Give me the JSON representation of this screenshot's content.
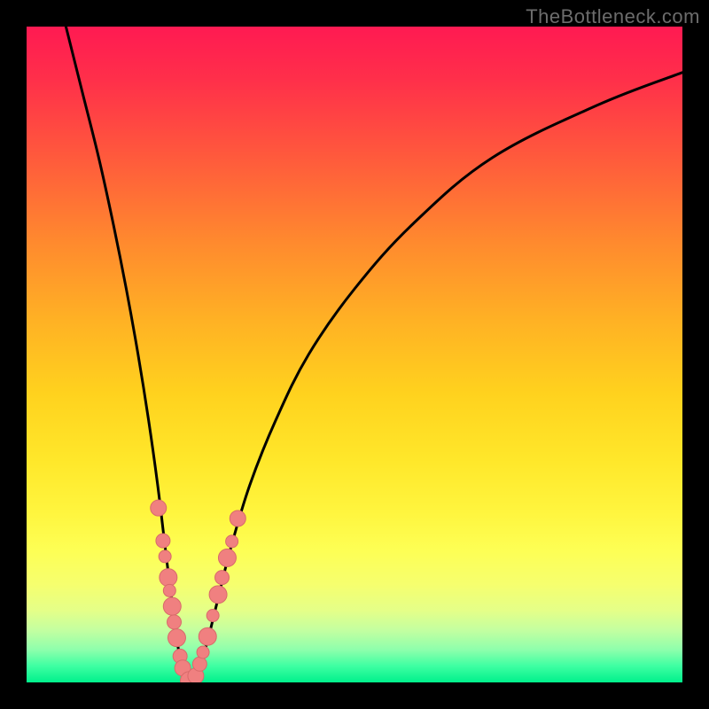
{
  "watermark": "TheBottleneck.com",
  "colors": {
    "frame": "#000000",
    "curve": "#000000",
    "marker_fill": "#f08080",
    "marker_stroke": "#d86a6a",
    "watermark": "#6c6c6c"
  },
  "chart_data": {
    "type": "line",
    "title": "",
    "xlabel": "",
    "ylabel": "",
    "xlim": [
      0,
      1
    ],
    "ylim": [
      0,
      1
    ],
    "axes_visible": false,
    "gradient_background": "vertical red→yellow→green",
    "series": [
      {
        "name": "left-curve",
        "values": [
          [
            0.06,
            1.0
          ],
          [
            0.085,
            0.9
          ],
          [
            0.11,
            0.8
          ],
          [
            0.132,
            0.7
          ],
          [
            0.152,
            0.6
          ],
          [
            0.17,
            0.5
          ],
          [
            0.186,
            0.4
          ],
          [
            0.2,
            0.3
          ],
          [
            0.212,
            0.2
          ],
          [
            0.222,
            0.12
          ],
          [
            0.23,
            0.06
          ],
          [
            0.238,
            0.02
          ],
          [
            0.25,
            0.0
          ]
        ]
      },
      {
        "name": "right-curve",
        "values": [
          [
            0.25,
            0.0
          ],
          [
            0.262,
            0.02
          ],
          [
            0.275,
            0.06
          ],
          [
            0.29,
            0.12
          ],
          [
            0.31,
            0.2
          ],
          [
            0.34,
            0.3
          ],
          [
            0.38,
            0.4
          ],
          [
            0.43,
            0.5
          ],
          [
            0.5,
            0.6
          ],
          [
            0.59,
            0.7
          ],
          [
            0.71,
            0.8
          ],
          [
            0.87,
            0.88
          ],
          [
            1.0,
            0.93
          ]
        ]
      }
    ],
    "markers": [
      {
        "x": 0.201,
        "y": 0.266,
        "r": 9
      },
      {
        "x": 0.208,
        "y": 0.216,
        "r": 8
      },
      {
        "x": 0.211,
        "y": 0.192,
        "r": 7
      },
      {
        "x": 0.216,
        "y": 0.16,
        "r": 10
      },
      {
        "x": 0.218,
        "y": 0.14,
        "r": 7
      },
      {
        "x": 0.222,
        "y": 0.116,
        "r": 10
      },
      {
        "x": 0.225,
        "y": 0.092,
        "r": 8
      },
      {
        "x": 0.229,
        "y": 0.068,
        "r": 10
      },
      {
        "x": 0.234,
        "y": 0.04,
        "r": 8
      },
      {
        "x": 0.238,
        "y": 0.022,
        "r": 9
      },
      {
        "x": 0.248,
        "y": 0.003,
        "r": 10
      },
      {
        "x": 0.258,
        "y": 0.01,
        "r": 9
      },
      {
        "x": 0.264,
        "y": 0.028,
        "r": 8
      },
      {
        "x": 0.269,
        "y": 0.046,
        "r": 7
      },
      {
        "x": 0.276,
        "y": 0.07,
        "r": 10
      },
      {
        "x": 0.284,
        "y": 0.102,
        "r": 7
      },
      {
        "x": 0.292,
        "y": 0.134,
        "r": 10
      },
      {
        "x": 0.298,
        "y": 0.16,
        "r": 8
      },
      {
        "x": 0.306,
        "y": 0.19,
        "r": 10
      },
      {
        "x": 0.313,
        "y": 0.215,
        "r": 7
      },
      {
        "x": 0.322,
        "y": 0.25,
        "r": 9
      }
    ]
  }
}
